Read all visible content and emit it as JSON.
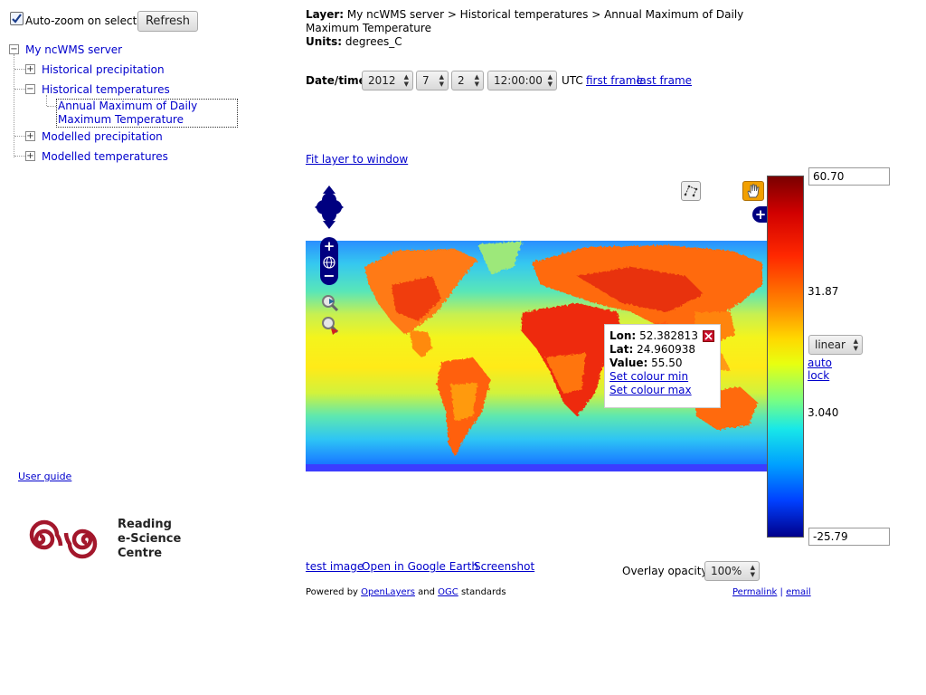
{
  "sidebar": {
    "auto_zoom_label": "Auto-zoom on select",
    "refresh_label": "Refresh",
    "tree": {
      "root": "My ncWMS server",
      "items": [
        {
          "label": "Historical precipitation"
        },
        {
          "label": "Historical temperatures"
        },
        {
          "label": "Annual Maximum of Daily Maximum Temperature"
        },
        {
          "label": "Modelled precipitation"
        },
        {
          "label": "Modelled temperatures"
        }
      ]
    },
    "user_guide": "User guide",
    "logo": {
      "line1": "Reading",
      "line2": "e-Science",
      "line3": "Centre",
      "color": "#a3172c"
    }
  },
  "header": {
    "layer_label": "Layer:",
    "layer_value": "My ncWMS server > Historical temperatures > Annual Maximum of Daily Maximum Temperature",
    "units_label": "Units:",
    "units_value": "degrees_C"
  },
  "datetime": {
    "label": "Date/time:",
    "year": "2012",
    "month": "7",
    "day": "2",
    "time": "12:00:00",
    "tz": "UTC",
    "first_frame": "first frame",
    "last_frame": "last frame"
  },
  "fit_layer": "Fit layer to window",
  "popup": {
    "lon_label": "Lon:",
    "lon_value": "52.382813",
    "lat_label": "Lat:",
    "lat_value": "24.960938",
    "value_label": "Value:",
    "value_value": "55.50",
    "set_min": "Set colour min",
    "set_max": "Set colour max"
  },
  "colorbar": {
    "max": "60.70",
    "mid_high": "31.87",
    "mid_low": "3.040",
    "min": "-25.79",
    "scale": "linear",
    "auto": "auto",
    "lock": "lock"
  },
  "bottom": {
    "test_image": "test image",
    "google_earth": "Open in Google Earth",
    "screenshot": "Screenshot",
    "opacity_label": "Overlay opacity:",
    "opacity_value": "100%",
    "powered_prefix": "Powered by",
    "openlayers": "OpenLayers",
    "and": "and",
    "ogc": "OGC",
    "standards": "standards",
    "permalink": "Permalink",
    "sep": "|",
    "email": "email"
  },
  "colors": {
    "link": "#0000cc",
    "nav_blue": "#000080",
    "ramp_low": "#00008b",
    "ramp_high": "#800000"
  }
}
